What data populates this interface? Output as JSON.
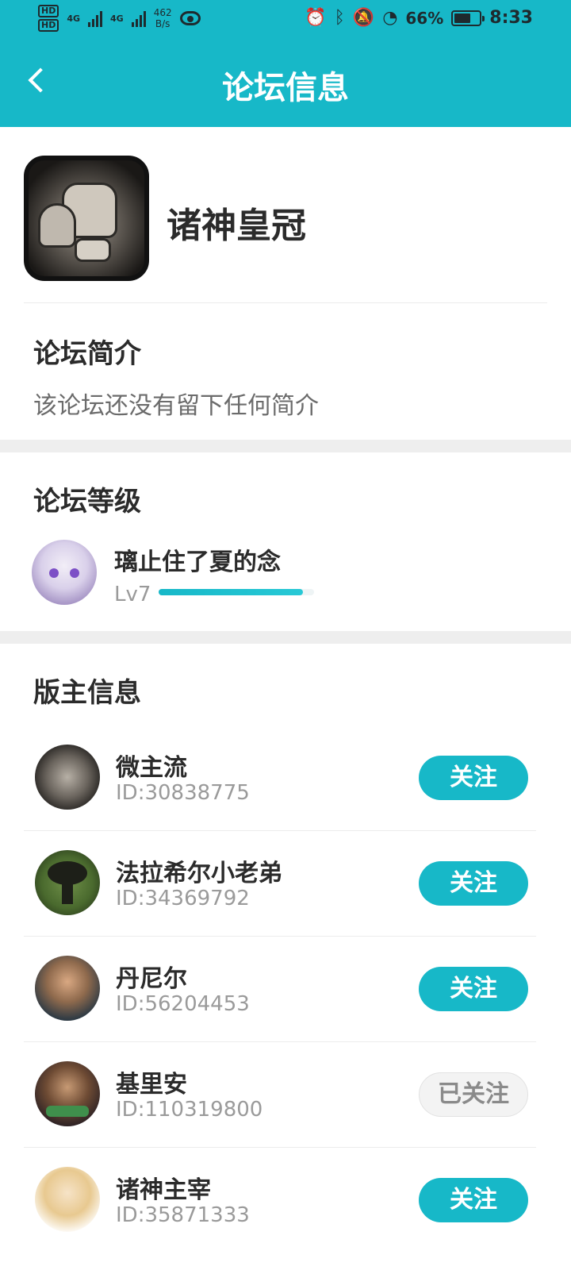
{
  "status_bar": {
    "hd1": "HD",
    "hd2": "HD",
    "net1": "4G",
    "net2": "4G",
    "speed_value": "462",
    "speed_unit": "B/s",
    "battery": "66%",
    "battery_level": 0.66,
    "time": "8:33",
    "icons": [
      "eye-icon",
      "alarm-icon",
      "bluetooth-icon",
      "bell-off-icon",
      "speedometer-icon",
      "battery-icon"
    ]
  },
  "header": {
    "title": "论坛信息",
    "back_icon": "chevron-left-icon"
  },
  "forum": {
    "name": "诸神皇冠",
    "icon": "armor-icon"
  },
  "intro": {
    "title": "论坛简介",
    "text": "该论坛还没有留下任何简介"
  },
  "level": {
    "title": "论坛等级",
    "user": "璃止住了夏的念",
    "level_label": "Lv7",
    "progress": 0.93
  },
  "moderators": {
    "title": "版主信息",
    "items": [
      {
        "name": "微主流",
        "id": "ID:30838775",
        "button": "关注",
        "followed": false
      },
      {
        "name": "法拉希尔小老弟",
        "id": "ID:34369792",
        "button": "关注",
        "followed": false
      },
      {
        "name": "丹尼尔",
        "id": "ID:56204453",
        "button": "关注",
        "followed": false
      },
      {
        "name": "基里安",
        "id": "ID:110319800",
        "button": "已关注",
        "followed": true
      },
      {
        "name": "诸神主宰",
        "id": "ID:35871333",
        "button": "关注",
        "followed": false
      }
    ]
  },
  "colors": {
    "accent": "#17b8c8",
    "followed_bg": "#f3f3f3"
  }
}
